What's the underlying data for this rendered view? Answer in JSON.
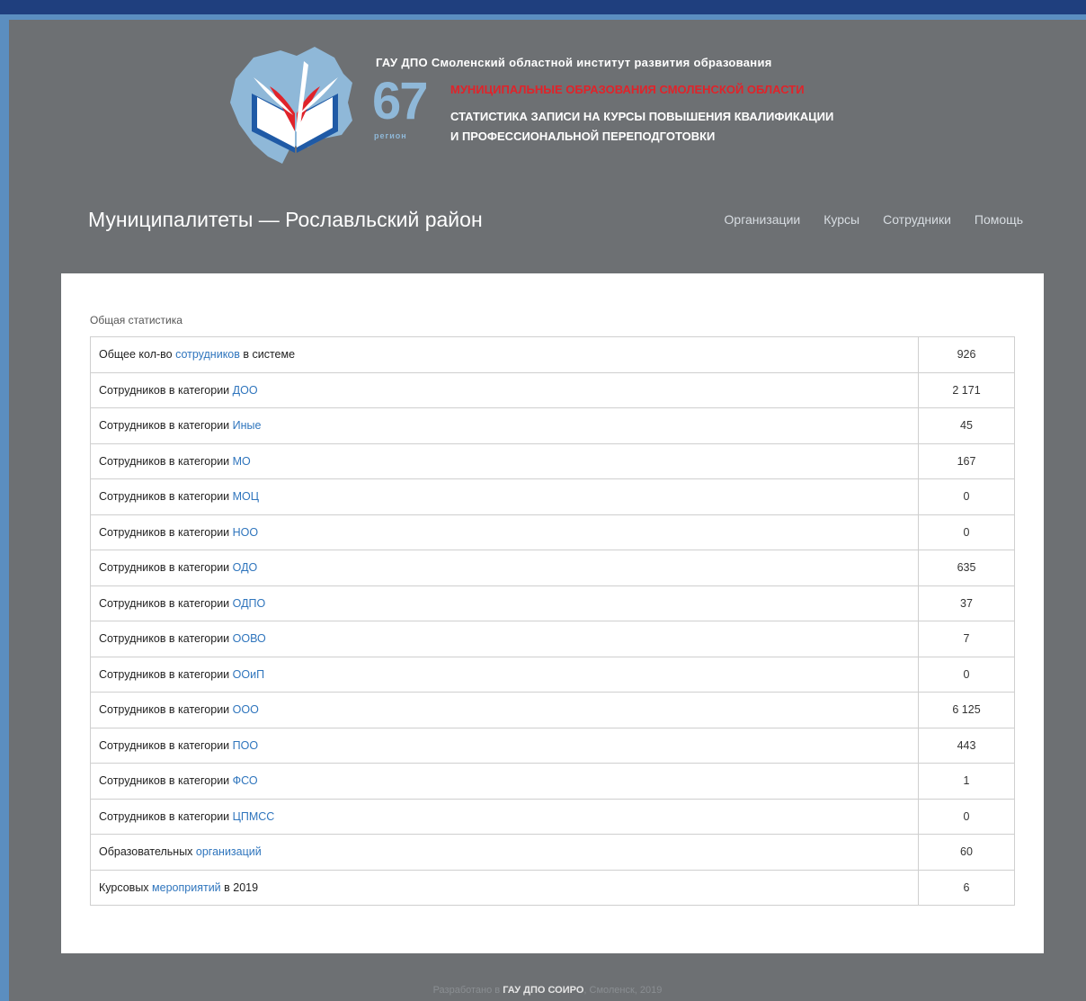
{
  "header": {
    "institute": "ГАУ ДПО Смоленский областной институт развития образования",
    "region_number": "67",
    "region_label": "регион",
    "red_title": "МУНИЦИПАЛЬНЫЕ ОБРАЗОВАНИЯ СМОЛЕНСКОЙ ОБЛАСТИ",
    "subtitle_line1": "СТАТИСТИКА ЗАПИСИ НА КУРСЫ ПОВЫШЕНИЯ КВАЛИФИКАЦИИ",
    "subtitle_line2": "И ПРОФЕССИОНАЛЬНОЙ ПЕРЕПОДГОТОВКИ"
  },
  "page_title": "Муниципалитеты — Рославльский район",
  "nav": [
    "Организации",
    "Курсы",
    "Сотрудники",
    "Помощь"
  ],
  "section_title": "Общая статистика",
  "rows": [
    {
      "prefix": "Общее кол-во ",
      "link": "сотрудников",
      "suffix": " в системе",
      "value": "926"
    },
    {
      "prefix": "Сотрудников в категории ",
      "link": "ДОО",
      "suffix": "",
      "value": "2 171"
    },
    {
      "prefix": "Сотрудников в категории ",
      "link": "Иные",
      "suffix": "",
      "value": "45"
    },
    {
      "prefix": "Сотрудников в категории ",
      "link": "МО",
      "suffix": "",
      "value": "167"
    },
    {
      "prefix": "Сотрудников в категории ",
      "link": "МОЦ",
      "suffix": "",
      "value": "0"
    },
    {
      "prefix": "Сотрудников в категории ",
      "link": "НОО",
      "suffix": "",
      "value": "0"
    },
    {
      "prefix": "Сотрудников в категории ",
      "link": "ОДО",
      "suffix": "",
      "value": "635"
    },
    {
      "prefix": "Сотрудников в категории ",
      "link": "ОДПО",
      "suffix": "",
      "value": "37"
    },
    {
      "prefix": "Сотрудников в категории ",
      "link": "ООВО",
      "suffix": "",
      "value": "7"
    },
    {
      "prefix": "Сотрудников в категории ",
      "link": "ООиП",
      "suffix": "",
      "value": "0"
    },
    {
      "prefix": "Сотрудников в категории ",
      "link": "ООО",
      "suffix": "",
      "value": "6 125"
    },
    {
      "prefix": "Сотрудников в категории ",
      "link": "ПОО",
      "suffix": "",
      "value": "443"
    },
    {
      "prefix": "Сотрудников в категории ",
      "link": "ФСО",
      "suffix": "",
      "value": "1"
    },
    {
      "prefix": "Сотрудников в категории ",
      "link": "ЦПМСС",
      "suffix": "",
      "value": "0"
    },
    {
      "prefix": "Образовательных ",
      "link": "организаций",
      "suffix": "",
      "value": "60"
    },
    {
      "prefix": "Курсовых ",
      "link": "мероприятий",
      "suffix": " в 2019",
      "value": "6"
    }
  ],
  "footer": {
    "prefix": "Разработано в ",
    "org": "ГАУ ДПО СОИРО",
    "suffix": ", Смоленск, 2019"
  },
  "colors": {
    "accent_link": "#2f75bd",
    "red": "#e0232a",
    "frame_bg": "#6d7073"
  }
}
